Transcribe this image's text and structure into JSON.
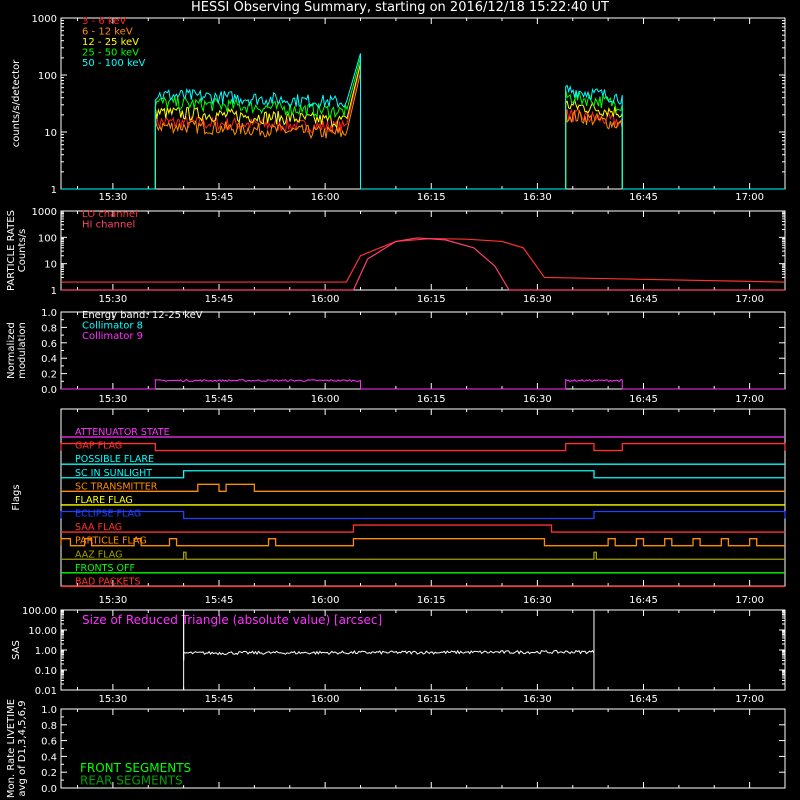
{
  "title": "HESSI Observing Summary, starting on 2016/12/18 15:22:40 UT",
  "time_ticks": [
    "15:30",
    "15:45",
    "16:00",
    "16:15",
    "16:30",
    "16:45",
    "17:00"
  ],
  "colors": {
    "3-6": "#ff2020",
    "6-12": "#ff8c00",
    "12-25": "#ffff00",
    "25-50": "#00ff00",
    "50-100": "#00ffff",
    "lo": "#ff3030",
    "hi": "#ff4070",
    "c8": "#00ffff",
    "c9": "#ff30ff"
  },
  "chart_data": [
    {
      "type": "line",
      "id": "counts",
      "ylabel": "counts/s/detector",
      "scale": "log",
      "ylim": [
        1,
        1000
      ],
      "yticks": [
        "1",
        "10",
        "100",
        "1000"
      ],
      "legend": [
        "3 - 6 keV",
        "6 - 12 keV",
        "12 - 25 keV",
        "25 - 50 keV",
        "50 - 100 keV"
      ],
      "series": [
        {
          "name": "3 - 6 keV",
          "segments": [
            {
              "t0": "15:36",
              "t1": "16:05",
              "v0": 15,
              "v1": 12,
              "end_peak": 150
            },
            {
              "t0": "16:34",
              "t1": "16:42",
              "v0": 20,
              "v1": 15
            }
          ]
        },
        {
          "name": "6 - 12 keV",
          "segments": [
            {
              "t0": "15:36",
              "t1": "16:05",
              "v0": 13,
              "v1": 9,
              "end_peak": 110
            },
            {
              "t0": "16:34",
              "t1": "16:42",
              "v0": 20,
              "v1": 13
            }
          ]
        },
        {
          "name": "12 - 25 keV",
          "segments": [
            {
              "t0": "15:36",
              "t1": "16:05",
              "v0": 22,
              "v1": 15,
              "end_peak": 160
            },
            {
              "t0": "16:34",
              "t1": "16:42",
              "v0": 30,
              "v1": 22
            }
          ]
        },
        {
          "name": "25 - 50 keV",
          "segments": [
            {
              "t0": "15:36",
              "t1": "16:05",
              "v0": 33,
              "v1": 22,
              "end_peak": 200
            },
            {
              "t0": "16:34",
              "t1": "16:42",
              "v0": 42,
              "v1": 30
            }
          ]
        },
        {
          "name": "50 - 100 keV",
          "segments": [
            {
              "t0": "15:36",
              "t1": "16:05",
              "v0": 45,
              "v1": 32,
              "end_peak": 240
            },
            {
              "t0": "16:34",
              "t1": "16:42",
              "v0": 55,
              "v1": 40
            }
          ]
        }
      ]
    },
    {
      "type": "line",
      "id": "particle",
      "ylabel": "PARTICLE RATES\nCounts/s",
      "scale": "log",
      "ylim": [
        1,
        1000
      ],
      "yticks": [
        "1",
        "10",
        "100",
        "1000"
      ],
      "legend": [
        "LO channel",
        "HI channel"
      ],
      "series": [
        {
          "name": "LO channel",
          "points": [
            [
              "15:22:40",
              2
            ],
            [
              "16:03",
              2
            ],
            [
              "16:05",
              20
            ],
            [
              "16:10",
              70
            ],
            [
              "16:15",
              90
            ],
            [
              "16:20",
              85
            ],
            [
              "16:25",
              70
            ],
            [
              "16:28",
              40
            ],
            [
              "16:31",
              3
            ],
            [
              "17:05",
              2
            ]
          ]
        },
        {
          "name": "HI channel",
          "points": [
            [
              "15:22:40",
              1
            ],
            [
              "16:04",
              1
            ],
            [
              "16:06",
              15
            ],
            [
              "16:10",
              70
            ],
            [
              "16:13",
              95
            ],
            [
              "16:17",
              80
            ],
            [
              "16:21",
              40
            ],
            [
              "16:24",
              8
            ],
            [
              "16:26",
              1
            ],
            [
              "17:05",
              1
            ]
          ]
        }
      ]
    },
    {
      "type": "line",
      "id": "modulation",
      "ylabel": "Normalized\nmodulation",
      "scale": "linear",
      "ylim": [
        0,
        1
      ],
      "yticks": [
        "0.0",
        "0.2",
        "0.4",
        "0.6",
        "0.8",
        "1.0"
      ],
      "legend": [
        "Energy band: 12-25 keV",
        "Collimator 8",
        "Collimator 9"
      ],
      "series": [
        {
          "name": "Collimator 9",
          "segments": [
            {
              "t0": "15:36",
              "t1": "16:05",
              "v0": 0.11,
              "v1": 0.11
            },
            {
              "t0": "16:34",
              "t1": "16:42",
              "v0": 0.11,
              "v1": 0.11
            }
          ]
        }
      ]
    },
    {
      "type": "flags",
      "id": "flags",
      "ylabel": "Flags",
      "rows": [
        {
          "name": "ATTENUATOR STATE",
          "color": "#ff30ff",
          "highs": []
        },
        {
          "name": "GAP FLAG",
          "color": "#ff3030",
          "highs": [
            [
              "15:22:40",
              "15:36"
            ],
            [
              "16:34",
              "16:38"
            ],
            [
              "16:42",
              "17:05"
            ]
          ]
        },
        {
          "name": "POSSIBLE FLARE",
          "color": "#00ffff",
          "highs": []
        },
        {
          "name": "SC IN SUNLIGHT",
          "color": "#00ffff",
          "highs": [
            [
              "15:40",
              "16:38"
            ]
          ]
        },
        {
          "name": "SC TRANSMITTER",
          "color": "#ff8c00",
          "highs": [
            [
              "15:42",
              "15:45"
            ],
            [
              "15:46",
              "15:50"
            ]
          ]
        },
        {
          "name": "FLARE FLAG",
          "color": "#ffff00",
          "highs": []
        },
        {
          "name": "ECLIPSE FLAG",
          "color": "#2040ff",
          "highs": [
            [
              "15:22:40",
              "15:40"
            ],
            [
              "16:38",
              "17:05"
            ]
          ]
        },
        {
          "name": "SAA FLAG",
          "color": "#ff3030",
          "highs": [
            [
              "16:04",
              "16:32"
            ]
          ]
        },
        {
          "name": "PARTICLE FLAG",
          "color": "#ff8c00",
          "highs": [
            [
              "15:22:40",
              "15:24"
            ],
            [
              "15:26",
              "15:27"
            ],
            [
              "15:33",
              "15:34"
            ],
            [
              "15:38",
              "15:39"
            ],
            [
              "15:52",
              "15:53"
            ],
            [
              "16:04",
              "16:31"
            ],
            [
              "16:40",
              "16:41"
            ],
            [
              "16:44",
              "16:45"
            ],
            [
              "16:48",
              "16:49"
            ],
            [
              "16:52",
              "16:53"
            ],
            [
              "16:56",
              "16:57"
            ],
            [
              "17:00",
              "17:01"
            ]
          ]
        },
        {
          "name": "AAZ FLAG",
          "color": "#a0a000",
          "highs": [
            [
              "15:40",
              "15:40:20"
            ],
            [
              "16:38",
              "16:38:20"
            ]
          ]
        },
        {
          "name": "FRONTS OFF",
          "color": "#00ff00",
          "highs": []
        },
        {
          "name": "BAD PACKETS",
          "color": "#ff3030",
          "highs": []
        }
      ]
    },
    {
      "type": "line",
      "id": "sas",
      "ylabel": "SAS",
      "scale": "log",
      "ylim": [
        0.01,
        100
      ],
      "yticks": [
        "0.01",
        "0.10",
        "1.00",
        "10.00",
        "100.00"
      ],
      "legend": [
        "Size of Reduced Triangle (absolute value) [arcsec]"
      ],
      "series": [
        {
          "name": "Size of Reduced Triangle (absolute value) [arcsec]",
          "segments": [
            {
              "t0": "15:40",
              "t1": "16:38",
              "v0": 0.7,
              "v1": 0.8
            }
          ]
        }
      ]
    },
    {
      "type": "line",
      "id": "livetime",
      "ylabel": "Mon. Rate LIVETIME\navg of D1,3,4,5,6,9",
      "scale": "linear",
      "ylim": [
        0,
        1
      ],
      "yticks": [
        "0.0",
        "0.2",
        "0.4",
        "0.6",
        "0.8",
        "1.0"
      ],
      "legend": [
        "FRONT SEGMENTS",
        "REAR SEGMENTS"
      ],
      "series": []
    }
  ]
}
